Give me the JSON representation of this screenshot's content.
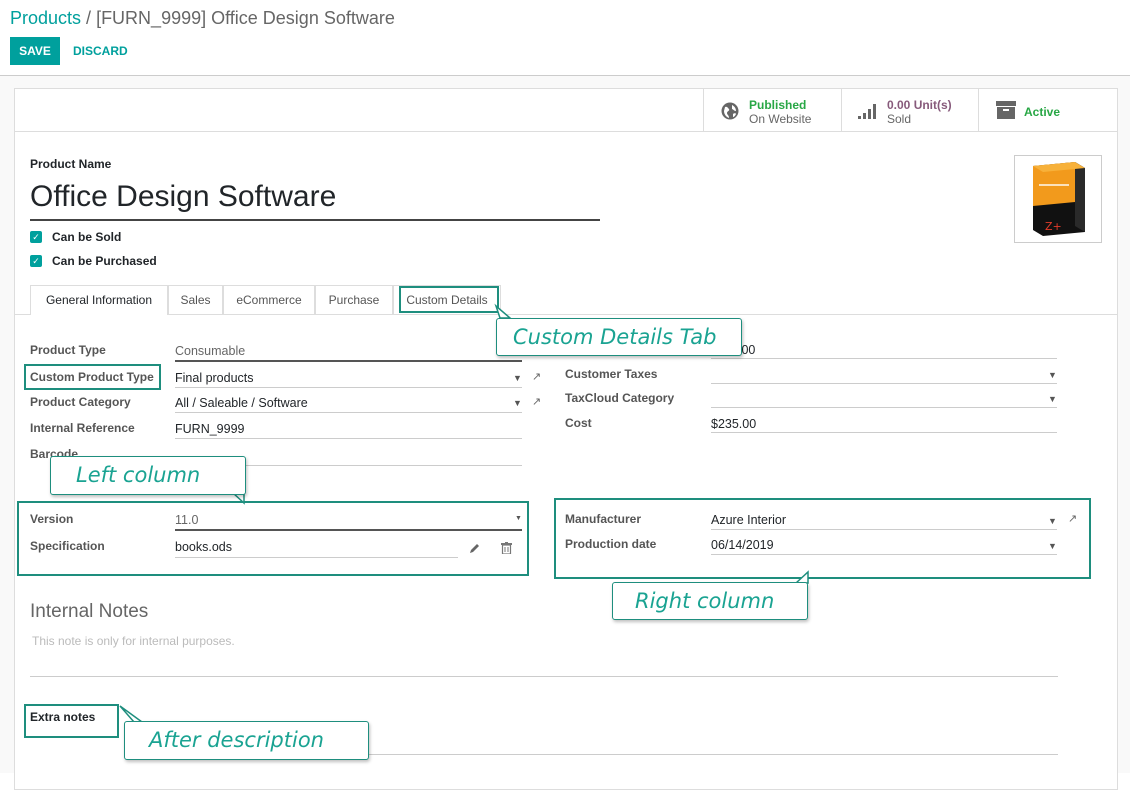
{
  "breadcrumb": {
    "root": "Products",
    "sep": " / ",
    "current": "[FURN_9999] Office Design Software"
  },
  "buttons": {
    "save": "SAVE",
    "discard": "DISCARD"
  },
  "smart_buttons": {
    "published": {
      "line1": "Published",
      "line2": "On Website",
      "icon": "globe-icon"
    },
    "sold": {
      "line1": "0.00 Unit(s)",
      "line2": "Sold",
      "icon": "bar-chart-icon"
    },
    "active": {
      "label": "Active",
      "icon": "archive-icon"
    }
  },
  "product": {
    "name_label": "Product Name",
    "name": "Office Design Software",
    "can_be_sold": "Can be Sold",
    "can_be_purchased": "Can be Purchased"
  },
  "tabs": [
    {
      "label": "General Information"
    },
    {
      "label": "Sales"
    },
    {
      "label": "eCommerce"
    },
    {
      "label": "Purchase"
    },
    {
      "label": "Custom Details"
    }
  ],
  "left_fields": {
    "product_type": {
      "label": "Product Type",
      "value": "Consumable"
    },
    "custom_product_type": {
      "label": "Custom Product Type",
      "value": "Final products"
    },
    "product_category": {
      "label": "Product Category",
      "value": "All / Saleable / Software"
    },
    "internal_reference": {
      "label": "Internal Reference",
      "value": "FURN_9999"
    },
    "barcode": {
      "label": "Barcode",
      "value": ""
    }
  },
  "right_fields": {
    "sales_price_partial": ".00",
    "customer_taxes": {
      "label": "Customer Taxes",
      "value": ""
    },
    "taxcloud_category": {
      "label": "TaxCloud Category",
      "value": ""
    },
    "cost": {
      "label": "Cost",
      "value": "$235.00"
    }
  },
  "custom_left": {
    "version": {
      "label": "Version",
      "value": "11.0"
    },
    "specification": {
      "label": "Specification",
      "value": "books.ods"
    }
  },
  "custom_right": {
    "manufacturer": {
      "label": "Manufacturer",
      "value": "Azure Interior"
    },
    "production_date": {
      "label": "Production date",
      "value": "06/14/2019"
    }
  },
  "notes": {
    "title": "Internal Notes",
    "placeholder": "This note is only for internal purposes.",
    "extra_label": "Extra notes"
  },
  "callouts": {
    "custom_tab": "Custom Details Tab",
    "left_column": "Left column",
    "right_column": "Right column",
    "after_description": "After description"
  },
  "colors": {
    "accent": "#00A09D",
    "annotation": "#1e8e7e",
    "annotation_text": "#1aa392",
    "sold_purple": "#875A7B",
    "published_green": "#28a745"
  }
}
